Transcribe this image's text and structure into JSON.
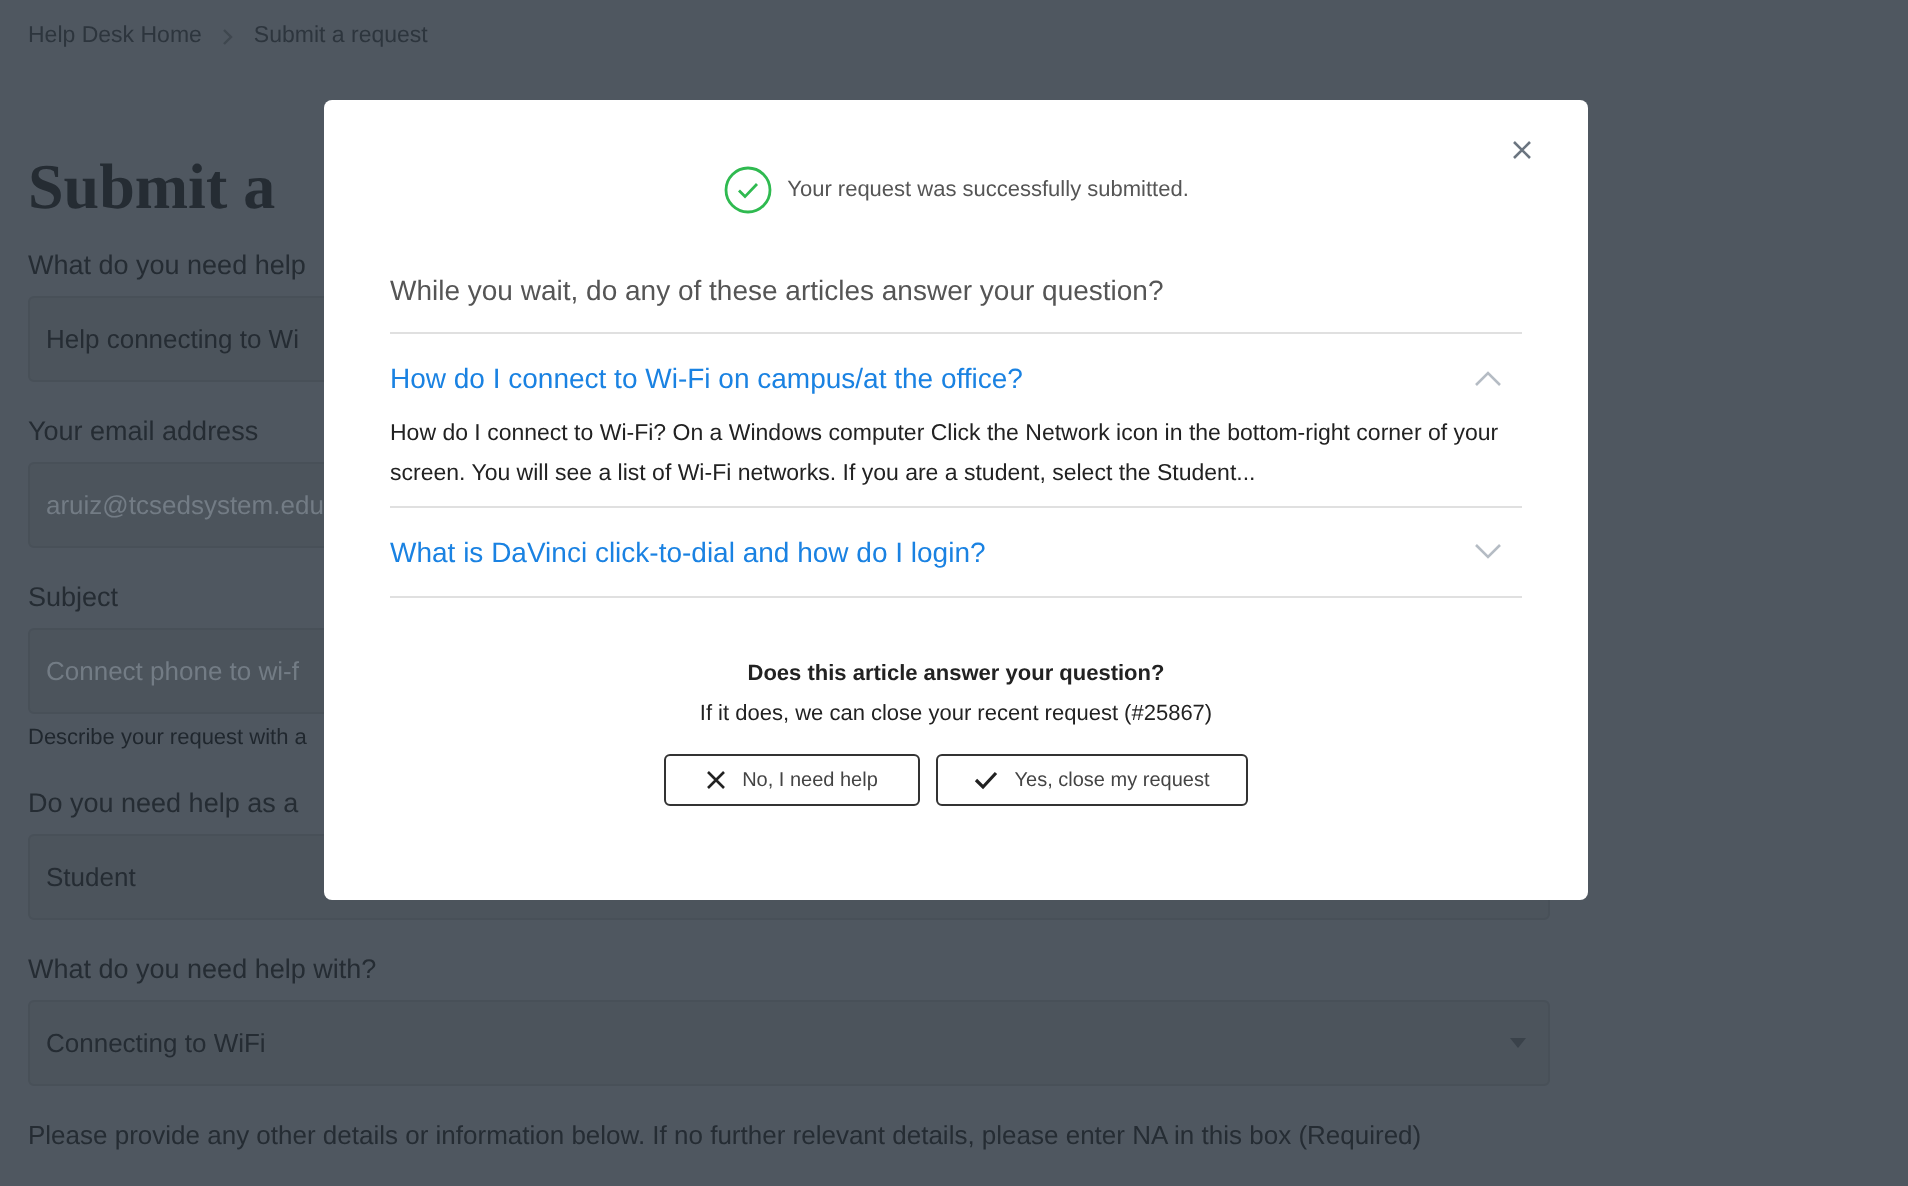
{
  "breadcrumbs": [
    {
      "label": "Help Desk Home"
    },
    {
      "label": "Submit a request"
    }
  ],
  "page_title": "Submit a",
  "form": {
    "fields": [
      {
        "kind": "text",
        "label": "What do you need help",
        "value": "Help connecting to Wi"
      },
      {
        "kind": "text",
        "label": "Your email address",
        "placeholder": "aruiz@tcsedsystem.edu"
      },
      {
        "kind": "text",
        "label": "Subject",
        "placeholder": "Connect phone to wi-f",
        "hint": "Describe your request with a"
      },
      {
        "kind": "select",
        "label": "Do you need help as a",
        "value": "Student"
      },
      {
        "kind": "select",
        "label": "What do you need help with?",
        "value": "Connecting to WiFi"
      }
    ],
    "footer_note": "Please provide any other details or information below. If no further relevant details, please enter NA in this box (Required)"
  },
  "modal": {
    "status": "Your request was successfully submitted.",
    "intro": "While you wait, do any of these articles answer your question?",
    "articles": [
      {
        "title": "How do I connect to Wi-Fi on campus/at the office?",
        "expanded": true,
        "excerpt": "How do I connect to Wi-Fi? On a Windows computer Click the Network icon in the bottom-right corner of your screen. You will see a list of Wi-Fi networks. If you are a student, select the Student..."
      },
      {
        "title": "What is DaVinci click-to-dial and how do I login?",
        "expanded": false
      }
    ],
    "question": "Does this article answer your question?",
    "note": "If it does, we can close your recent request (#25867)",
    "buttons": [
      {
        "kind": "no",
        "label": "No, I need help"
      },
      {
        "kind": "yes",
        "label": "Yes, close my request"
      }
    ]
  }
}
